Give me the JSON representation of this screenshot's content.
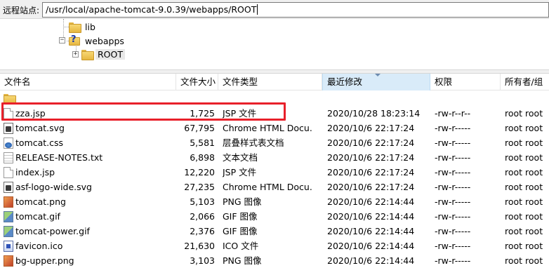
{
  "site_bar": {
    "label": "远程站点:",
    "path": "/usr/local/apache-tomcat-9.0.39/webapps/ROOT"
  },
  "tree": [
    {
      "label": "lib",
      "icon": "folder-icon",
      "expander": ""
    },
    {
      "label": "webapps",
      "icon": "folder-unknown-icon",
      "expander": "−"
    },
    {
      "label": "ROOT",
      "icon": "folder-icon",
      "expander": "+",
      "selected": true
    }
  ],
  "columns": {
    "name": "文件名",
    "size": "文件大小",
    "type": "文件类型",
    "modified": "最近修改",
    "perms": "权限",
    "owner": "所有者/组"
  },
  "files": [
    {
      "name": "",
      "size": "",
      "type": "",
      "modified": "",
      "perms": "",
      "owner": "",
      "icon": "folder-icon"
    },
    {
      "name": "zza.jsp",
      "size": "1,725",
      "type": "JSP 文件",
      "modified": "2020/10/28 18:23:14",
      "perms": "-rw-r--r--",
      "owner": "root root",
      "icon": "document-icon"
    },
    {
      "name": "tomcat.svg",
      "size": "67,795",
      "type": "Chrome HTML Docu...",
      "modified": "2020/10/6 22:17:24",
      "perms": "-rw-r-----",
      "owner": "root root",
      "icon": "svg-file-icon"
    },
    {
      "name": "tomcat.css",
      "size": "5,581",
      "type": "层叠样式表文档",
      "modified": "2020/10/6 22:17:24",
      "perms": "-rw-r-----",
      "owner": "root root",
      "icon": "css-file-icon"
    },
    {
      "name": "RELEASE-NOTES.txt",
      "size": "6,898",
      "type": "文本文档",
      "modified": "2020/10/6 22:17:24",
      "perms": "-rw-r-----",
      "owner": "root root",
      "icon": "text-file-icon"
    },
    {
      "name": "index.jsp",
      "size": "12,220",
      "type": "JSP 文件",
      "modified": "2020/10/6 22:17:24",
      "perms": "-rw-r-----",
      "owner": "root root",
      "icon": "document-icon"
    },
    {
      "name": "asf-logo-wide.svg",
      "size": "27,235",
      "type": "Chrome HTML Docu...",
      "modified": "2020/10/6 22:17:24",
      "perms": "-rw-r-----",
      "owner": "root root",
      "icon": "svg-file-icon"
    },
    {
      "name": "tomcat.png",
      "size": "5,103",
      "type": "PNG 图像",
      "modified": "2020/10/6 22:14:44",
      "perms": "-rw-r-----",
      "owner": "root root",
      "icon": "png-image-icon"
    },
    {
      "name": "tomcat.gif",
      "size": "2,066",
      "type": "GIF 图像",
      "modified": "2020/10/6 22:14:44",
      "perms": "-rw-r-----",
      "owner": "root root",
      "icon": "gif-image-icon"
    },
    {
      "name": "tomcat-power.gif",
      "size": "2,376",
      "type": "GIF 图像",
      "modified": "2020/10/6 22:14:44",
      "perms": "-rw-r-----",
      "owner": "root root",
      "icon": "gif-image-icon"
    },
    {
      "name": "favicon.ico",
      "size": "21,630",
      "type": "ICO 文件",
      "modified": "2020/10/6 22:14:44",
      "perms": "-rw-r-----",
      "owner": "root root",
      "icon": "ico-file-icon"
    },
    {
      "name": "bg-upper.png",
      "size": "3,103",
      "type": "PNG 图像",
      "modified": "2020/10/6 22:14:44",
      "perms": "-rw-r-----",
      "owner": "root root",
      "icon": "png-image-icon"
    }
  ],
  "highlight_color": "#e8202a",
  "sorted_column_color": "#d9ebf9"
}
